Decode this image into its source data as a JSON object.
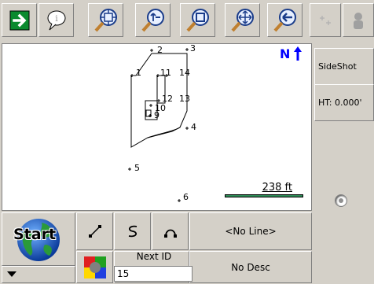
{
  "toolbar": {
    "icons": [
      "go-arrow-icon",
      "callout-icon",
      "zoom-extents-icon",
      "zoom-out-icon",
      "zoom-window-icon",
      "pan-icon",
      "zoom-previous-icon",
      "move-point-icon",
      "user-icon"
    ]
  },
  "map": {
    "north_label": "N",
    "points": [
      {
        "id": "1",
        "label": "1"
      },
      {
        "id": "2",
        "label": "2"
      },
      {
        "id": "3",
        "label": "3"
      },
      {
        "id": "4",
        "label": "4"
      },
      {
        "id": "5",
        "label": "5"
      },
      {
        "id": "6",
        "label": "6"
      },
      {
        "id": "9",
        "label": "9"
      },
      {
        "id": "10",
        "label": "10"
      },
      {
        "id": "11",
        "label": "11"
      },
      {
        "id": "12",
        "label": "12"
      },
      {
        "id": "13",
        "label": "13"
      },
      {
        "id": "14",
        "label": "14"
      }
    ],
    "scale_label": "238 ft"
  },
  "right_panel": {
    "sideshot_label": "SideShot",
    "ht_label": "HT: 0.000'"
  },
  "bottom": {
    "start_label": "Start",
    "line_label": "<No Line>",
    "next_id_label": "Next ID",
    "next_id_value": "15",
    "desc_label": "No Desc"
  },
  "colors": {
    "toolbar_bg": "#d4d0c8",
    "go_green": "#0a8a2e",
    "north_blue": "#0000ff",
    "scale_green": "#2e8b57"
  }
}
